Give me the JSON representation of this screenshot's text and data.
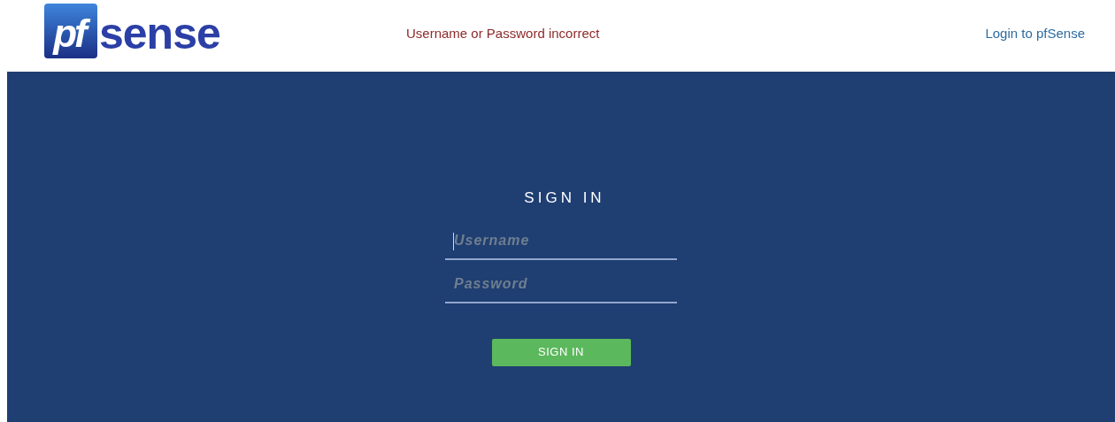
{
  "header": {
    "logo": {
      "mark": "pf",
      "word": "sense"
    },
    "error_message": "Username or Password incorrect",
    "title_link": "Login to pfSense"
  },
  "login": {
    "heading": "SIGN IN",
    "fields": [
      {
        "placeholder": "Username",
        "focused": true
      },
      {
        "placeholder": "Password",
        "focused": false
      }
    ],
    "button": "SIGN IN"
  }
}
